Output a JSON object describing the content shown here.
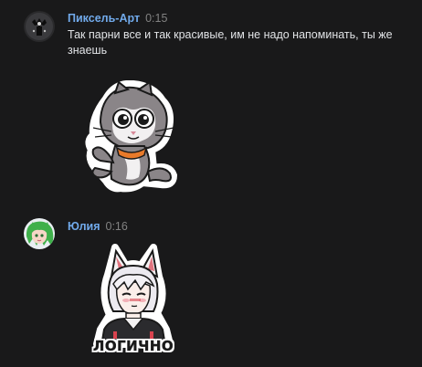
{
  "messages": [
    {
      "author": "Пиксель-Арт",
      "time": "0:15",
      "text": "Так парни все и так красивые, им не надо напоминать, ты же знаешь",
      "sticker": "cat-sticker"
    },
    {
      "author": "Юлия",
      "time": "0:16",
      "text": "",
      "sticker": "fox-eared-boy-sticker",
      "sticker_caption": "ЛОГИЧНО"
    }
  ],
  "colors": {
    "background": "#19191a",
    "author": "#71aaeb",
    "time": "#828282",
    "text": "#e1e3e6"
  }
}
